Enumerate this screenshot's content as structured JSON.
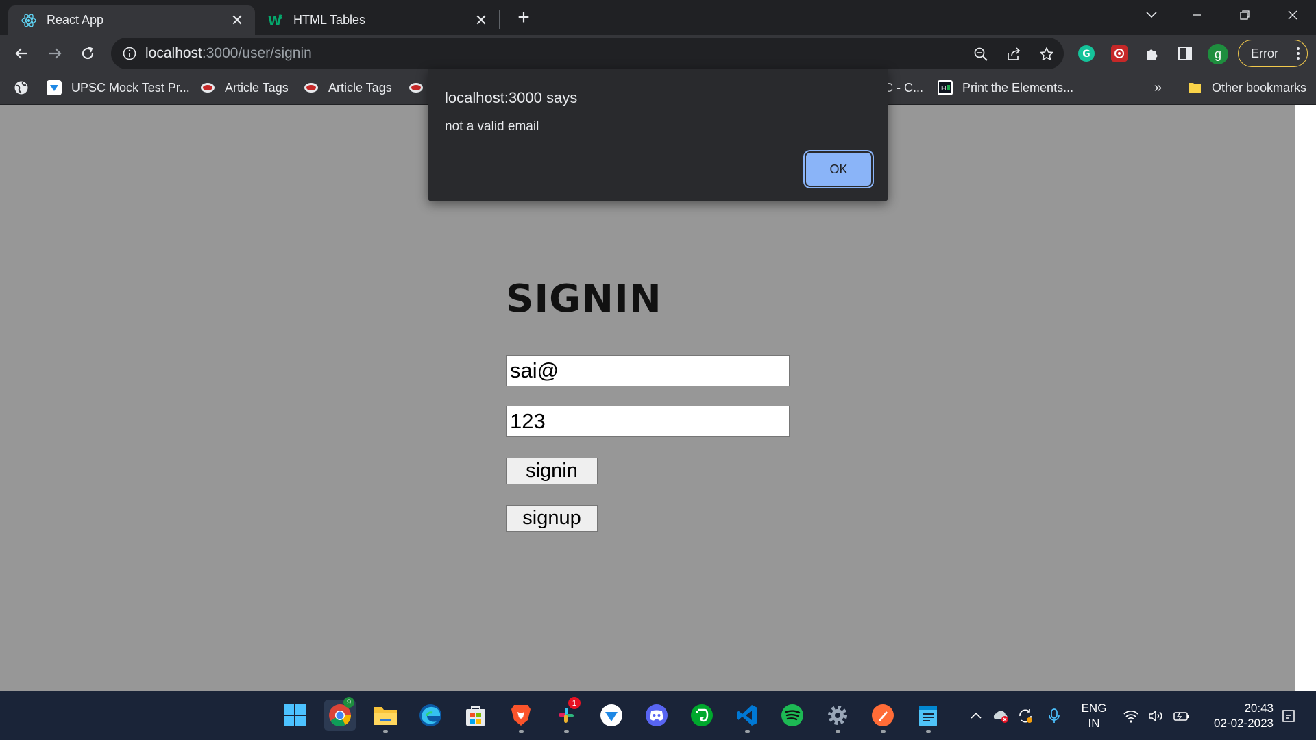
{
  "browser": {
    "tabs": [
      {
        "label": "React App",
        "icon": "react-icon",
        "active": true
      },
      {
        "label": "HTML Tables",
        "icon": "w3schools-icon",
        "active": false
      }
    ],
    "url_host": "localhost",
    "url_path": ":3000/user/signin",
    "error_label": "Error",
    "profile_initial": "g",
    "bookmarks": [
      {
        "label": "UPSC Mock Test Pr..."
      },
      {
        "label": "Article Tags"
      },
      {
        "label": "Article Tags"
      },
      {
        "label": "C - C..."
      },
      {
        "label": "Print the Elements..."
      }
    ],
    "bookmarks_overflow": "»",
    "other_bookmarks": "Other bookmarks"
  },
  "dialog": {
    "title": "localhost:3000 says",
    "message": "not a valid email",
    "ok_label": "OK"
  },
  "page": {
    "title": "SIGNIN",
    "email_value": "sai@",
    "password_value": "123",
    "signin_label": "signin",
    "signup_label": "signup"
  },
  "taskbar": {
    "chrome_badge": "9",
    "slack_badge": "1",
    "lang_top": "ENG",
    "lang_bottom": "IN",
    "time": "20:43",
    "date": "02-02-2023"
  }
}
